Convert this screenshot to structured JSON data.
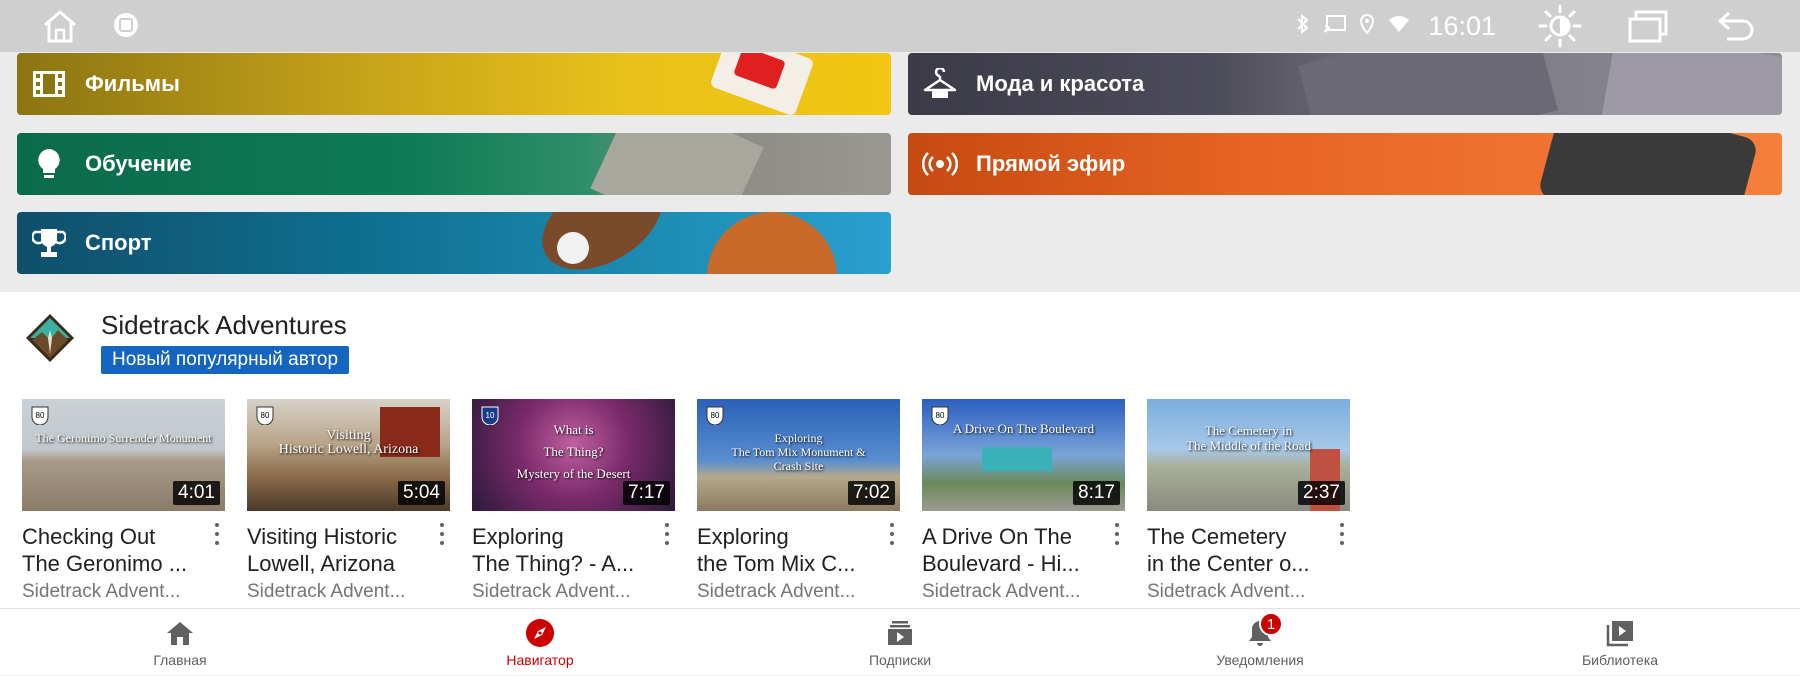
{
  "statusbar": {
    "time": "16:01",
    "icons": [
      "home-icon",
      "app-icon",
      "bluetooth-icon",
      "cast-icon",
      "location-icon",
      "wifi-icon",
      "brightness-icon",
      "recent-apps-icon",
      "back-icon"
    ]
  },
  "categories": [
    {
      "label": "Фильмы",
      "icon": "film-icon"
    },
    {
      "label": "Мода и красота",
      "icon": "hanger-icon"
    },
    {
      "label": "Обучение",
      "icon": "lightbulb-icon"
    },
    {
      "label": "Прямой эфир",
      "icon": "broadcast-icon"
    },
    {
      "label": "Спорт",
      "icon": "trophy-icon"
    }
  ],
  "channel": {
    "name": "Sidetrack Adventures",
    "badge": "Новый популярный автор"
  },
  "videos": [
    {
      "title": "Checking Out\nThe Geronimo ...",
      "channel": "Sidetrack Advent...",
      "duration": "4:01",
      "thumb_text": "The Geronimo Surrender Monument",
      "thumb_colors": [
        "#b9c3c8",
        "#9a8f7e",
        "#7d6e5c"
      ]
    },
    {
      "title": "Visiting Historic\nLowell, Arizona",
      "channel": "Sidetrack Advent...",
      "duration": "5:04",
      "thumb_text": "Visiting\nHistoric Lowell, Arizona",
      "thumb_colors": [
        "#b8a487",
        "#8a6a4a",
        "#5a4535"
      ]
    },
    {
      "title": "Exploring\nThe Thing? - A...",
      "channel": "Sidetrack Advent...",
      "duration": "7:17",
      "thumb_text": "What is\nThe Thing?\nMystery of the Desert",
      "thumb_colors": [
        "#3a1f4a",
        "#8a2a7a",
        "#c04090"
      ]
    },
    {
      "title": "Exploring\nthe Tom Mix C...",
      "channel": "Sidetrack Advent...",
      "duration": "7:02",
      "thumb_text": "Exploring\nThe Tom Mix Monument &\nCrash Site",
      "thumb_colors": [
        "#2a5fb0",
        "#5a8fd0",
        "#8a7a60"
      ]
    },
    {
      "title": "A Drive On The\nBoulevard - Hi...",
      "channel": "Sidetrack Advent...",
      "duration": "8:17",
      "thumb_text": "A Drive On The Boulevard",
      "thumb_colors": [
        "#2a60c0",
        "#80a8d8",
        "#6a8a5a"
      ]
    },
    {
      "title": "The Cemetery\nin the Center o...",
      "channel": "Sidetrack Advent...",
      "duration": "2:37",
      "thumb_text": "The Cemetery in\nThe Middle of the Road",
      "thumb_colors": [
        "#8ab0d8",
        "#a8b8a0",
        "#8a8a80"
      ]
    }
  ],
  "bottomnav": [
    {
      "label": "Главная",
      "icon": "home-filled-icon",
      "active": false
    },
    {
      "label": "Навигатор",
      "icon": "compass-icon",
      "active": true
    },
    {
      "label": "Подписки",
      "icon": "subscriptions-icon",
      "active": false
    },
    {
      "label": "Уведомления",
      "icon": "bell-icon",
      "active": false,
      "badge": "1"
    },
    {
      "label": "Библиотека",
      "icon": "library-icon",
      "active": false
    }
  ],
  "colors": {
    "accent_red": "#cc0000",
    "badge_blue": "#1565c0"
  }
}
